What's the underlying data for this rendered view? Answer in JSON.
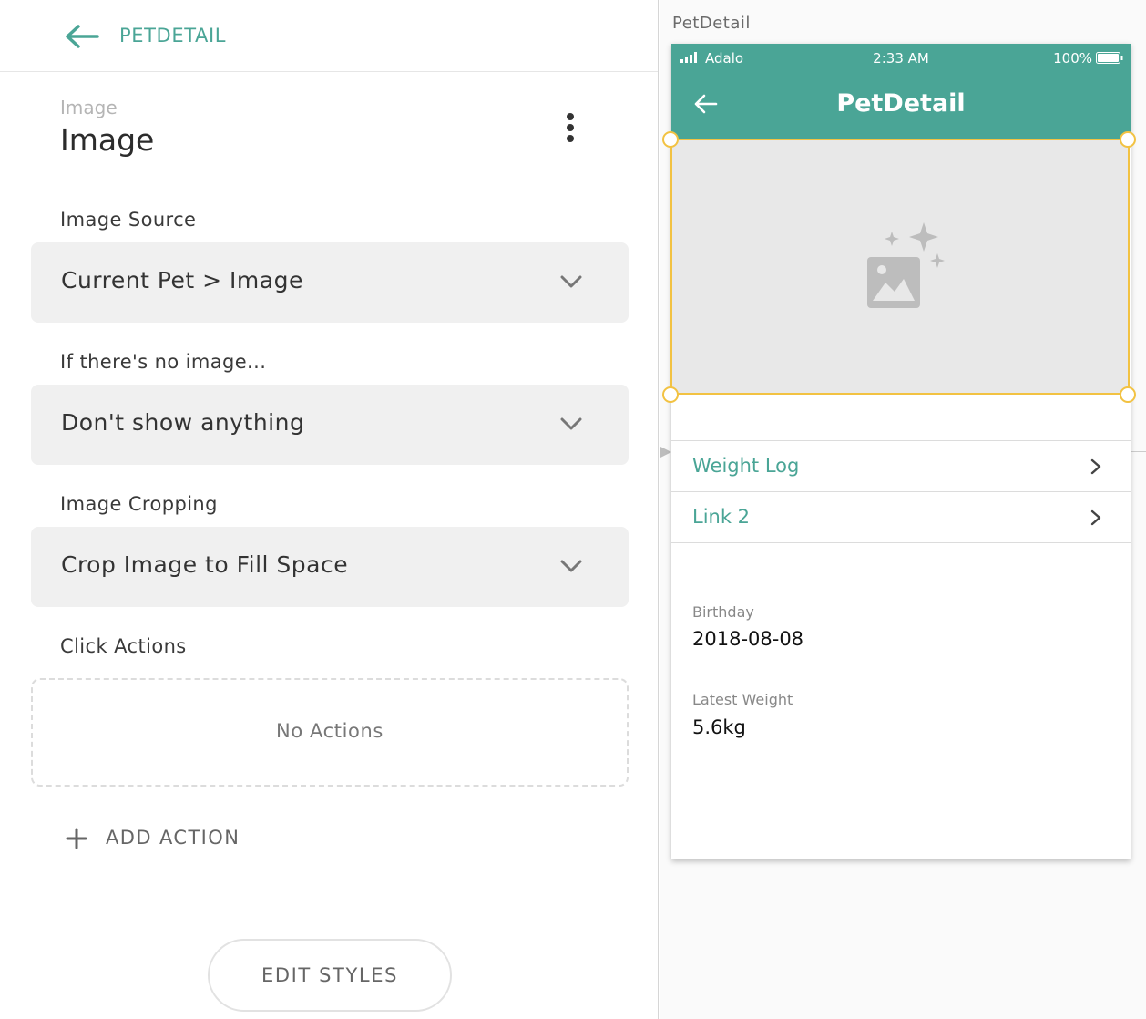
{
  "panel": {
    "back_label": "PETDETAIL",
    "component_type": "Image",
    "component_name": "Image",
    "fields": {
      "image_source": {
        "label": "Image Source",
        "value": "Current Pet > Image"
      },
      "no_image": {
        "label": "If there's no image...",
        "value": "Don't show anything"
      },
      "cropping": {
        "label": "Image Cropping",
        "value": "Crop Image to Fill Space"
      }
    },
    "click_actions": {
      "label": "Click Actions",
      "empty_text": "No Actions"
    },
    "add_action_label": "ADD ACTION",
    "edit_styles_label": "EDIT STYLES"
  },
  "canvas": {
    "screen_label": "PetDetail",
    "status_bar": {
      "carrier": "Adalo",
      "time": "2:33 AM",
      "battery": "100%"
    },
    "app_bar": {
      "title": "PetDetail"
    },
    "links": [
      {
        "label": "Weight Log"
      },
      {
        "label": "Link 2"
      }
    ],
    "details": [
      {
        "label": "Birthday",
        "value": "2018-08-08"
      },
      {
        "label": "Latest Weight",
        "value": "5.6kg"
      }
    ]
  },
  "colors": {
    "accent": "#4aa596",
    "selection": "#f2c242",
    "field_bg": "#f0f0f0"
  },
  "icons": [
    "back-arrow-icon",
    "more-vert-icon",
    "chevron-down-icon",
    "plus-icon",
    "signal-icon",
    "battery-icon",
    "image-placeholder-icon",
    "chevron-right-icon"
  ]
}
